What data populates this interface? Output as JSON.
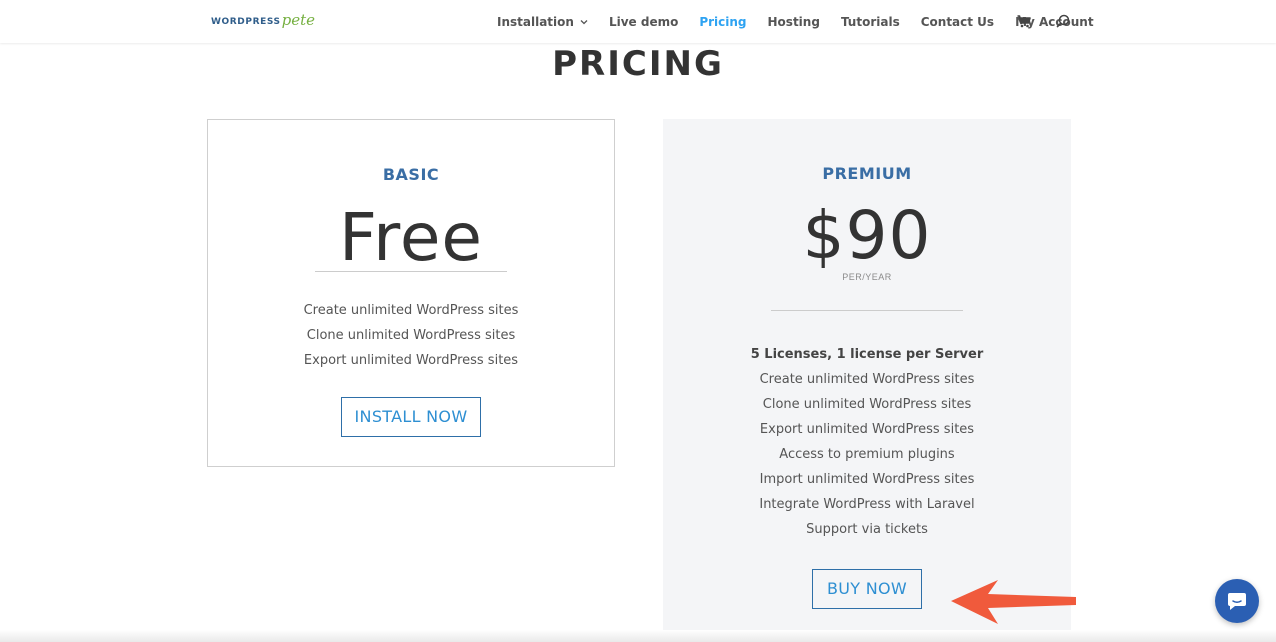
{
  "header": {
    "logo": {
      "main": "WORDPRESS",
      "accent": "pete"
    },
    "nav": [
      {
        "label": "Installation",
        "has_dropdown": true,
        "active": false
      },
      {
        "label": "Live demo",
        "active": false
      },
      {
        "label": "Pricing",
        "active": true
      },
      {
        "label": "Hosting",
        "active": false
      },
      {
        "label": "Tutorials",
        "active": false
      },
      {
        "label": "Contact Us",
        "active": false
      },
      {
        "label": "My Account",
        "active": false
      }
    ],
    "icons": {
      "cart": "cart-icon",
      "search": "search-icon"
    }
  },
  "page": {
    "title": "PRICING"
  },
  "plans": {
    "basic": {
      "name": "BASIC",
      "price": "Free",
      "features": [
        "Create unlimited WordPress sites",
        "Clone unlimited WordPress sites",
        "Export unlimited WordPress sites"
      ],
      "button_label": "INSTALL NOW"
    },
    "premium": {
      "name": "PREMIUM",
      "price": "$90",
      "period": "PER/YEAR",
      "features": [
        "5 Licenses, 1 license per Server",
        "Create unlimited WordPress sites",
        "Clone unlimited WordPress sites",
        "Export unlimited WordPress sites",
        "Access to premium plugins",
        "Import unlimited WordPress sites",
        "Integrate WordPress with Laravel",
        "Support via tickets"
      ],
      "button_label": "BUY NOW"
    }
  },
  "colors": {
    "accent": "#2ea3f2",
    "plan_name": "#3a6ea5",
    "logo_main": "#2f5d8a",
    "logo_accent": "#76b041",
    "arrow": "#f05a3c",
    "chat": "#2b5fb3",
    "premium_bg": "#f4f5f7"
  },
  "widgets": {
    "chat": "chat-icon",
    "annotation": "arrow-left-icon"
  }
}
